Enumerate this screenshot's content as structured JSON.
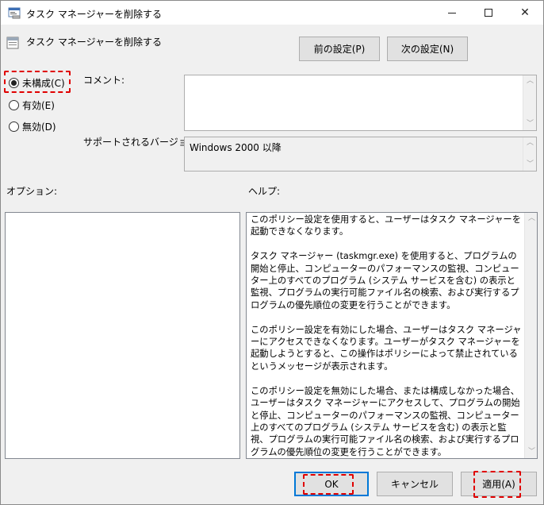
{
  "window": {
    "title": "タスク マネージャーを削除する",
    "controls": {
      "minimize": "—",
      "maximize": "□",
      "close": "✕"
    }
  },
  "header": {
    "title": "タスク マネージャーを削除する",
    "prev_setting": "前の設定(P)",
    "next_setting": "次の設定(N)"
  },
  "state": {
    "options": [
      {
        "label": "未構成(C)",
        "selected": true
      },
      {
        "label": "有効(E)",
        "selected": false
      },
      {
        "label": "無効(D)",
        "selected": false
      }
    ]
  },
  "comment": {
    "label": "コメント:",
    "value": ""
  },
  "supported": {
    "label": "サポートされるバージョン:",
    "value": "Windows 2000 以降"
  },
  "options_section": {
    "label": "オプション:"
  },
  "help_section": {
    "label": "ヘルプ:",
    "text": "このポリシー設定を使用すると、ユーザーはタスク マネージャーを起動できなくなります。\n\nタスク マネージャー (taskmgr.exe) を使用すると、プログラムの開始と停止、コンピューターのパフォーマンスの監視、コンピューター上のすべてのプログラム (システム サービスを含む) の表示と監視、プログラムの実行可能ファイル名の検索、および実行するプログラムの優先順位の変更を行うことができます。\n\nこのポリシー設定を有効にした場合、ユーザーはタスク マネージャーにアクセスできなくなります。ユーザーがタスク マネージャーを起動しようとすると、この操作はポリシーによって禁止されているというメッセージが表示されます。\n\nこのポリシー設定を無効にした場合、または構成しなかった場合、ユーザーはタスク マネージャーにアクセスして、プログラムの開始と停止、コンピューターのパフォーマンスの監視、コンピューター上のすべてのプログラム (システム サービスを含む) の表示と監視、プログラムの実行可能ファイル名の検索、および実行するプログラムの優先順位の変更を行うことができます。"
  },
  "footer": {
    "ok": "OK",
    "cancel": "キャンセル",
    "apply": "適用(A)"
  },
  "colors": {
    "highlight_dash": "#e00000",
    "accent": "#0078d7"
  },
  "icons": [
    "policy-icon",
    "radio-icon",
    "scroll-up-icon",
    "scroll-down-icon"
  ]
}
